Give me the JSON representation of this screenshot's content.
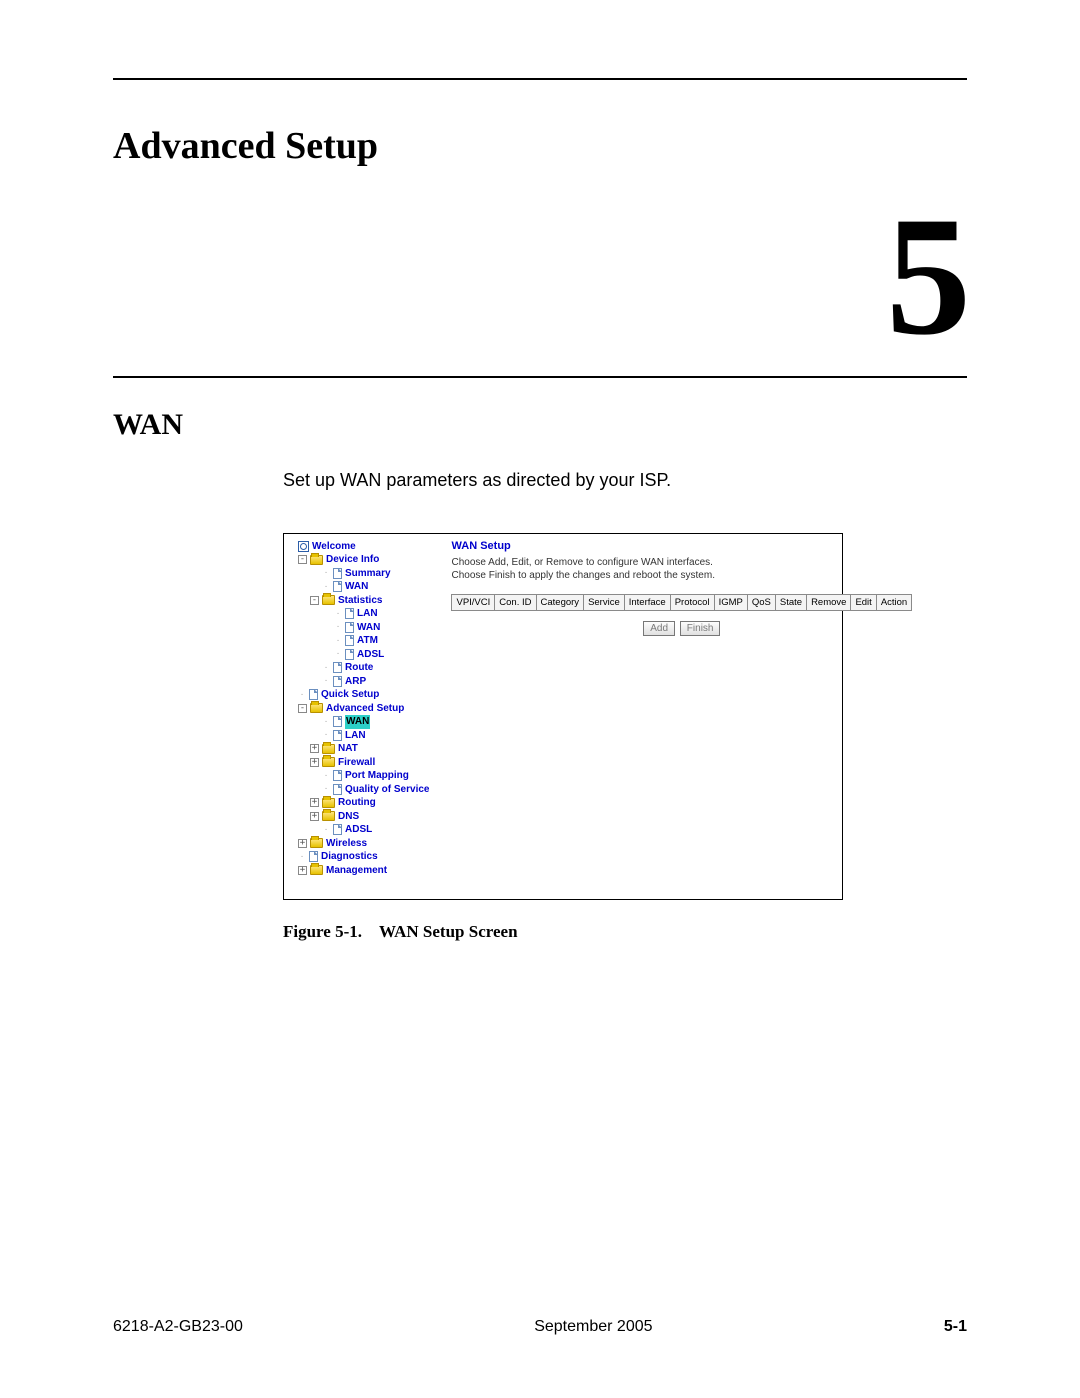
{
  "chapter": {
    "title": "Advanced Setup",
    "number": "5"
  },
  "section": {
    "title": "WAN",
    "body": "Set up WAN parameters as directed by your ISP."
  },
  "screenshot": {
    "panel": {
      "title": "WAN Setup",
      "line1": "Choose Add, Edit, or Remove to configure WAN interfaces.",
      "line2": "Choose Finish to apply the changes and reboot the system.",
      "headers": [
        "VPI/VCI",
        "Con. ID",
        "Category",
        "Service",
        "Interface",
        "Protocol",
        "IGMP",
        "QoS",
        "State",
        "Remove",
        "Edit",
        "Action"
      ],
      "buttons": {
        "add": "Add",
        "finish": "Finish"
      }
    },
    "tree": {
      "welcome": "Welcome",
      "device_info": "Device Info",
      "summary": "Summary",
      "wan": "WAN",
      "statistics": "Statistics",
      "lan": "LAN",
      "stat_wan": "WAN",
      "atm": "ATM",
      "adsl": "ADSL",
      "route": "Route",
      "arp": "ARP",
      "quick_setup": "Quick Setup",
      "advanced_setup": "Advanced Setup",
      "adv_wan": "WAN",
      "adv_lan": "LAN",
      "nat": "NAT",
      "firewall": "Firewall",
      "port_mapping": "Port Mapping",
      "qos": "Quality of Service",
      "routing": "Routing",
      "dns": "DNS",
      "adv_adsl": "ADSL",
      "wireless": "Wireless",
      "diagnostics": "Diagnostics",
      "management": "Management"
    }
  },
  "figure_caption_prefix": "Figure 5-1.",
  "figure_caption_text": "WAN Setup Screen",
  "footer": {
    "doc_id": "6218-A2-GB23-00",
    "date": "September 2005",
    "page": "5-1"
  }
}
